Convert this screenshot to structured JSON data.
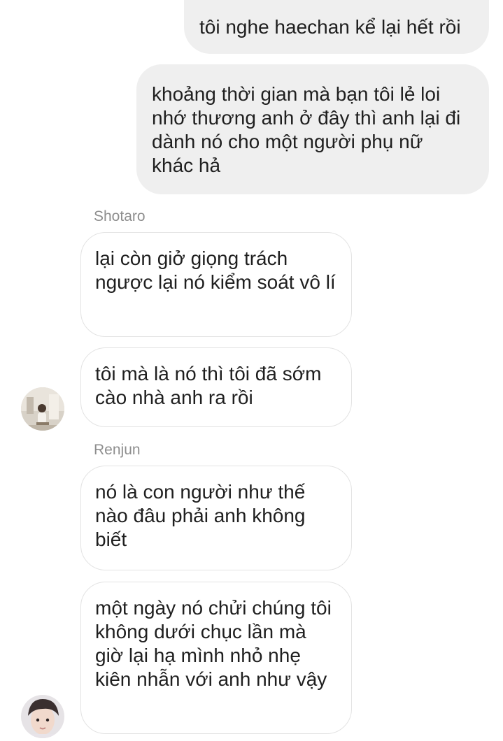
{
  "conversation": {
    "outgoing": [
      {
        "text": "tôi nghe haechan kể lại hết rồi"
      },
      {
        "text": "khoảng thời gian mà bạn tôi lẻ loi nhớ thương anh ở đây thì anh lại đi dành nó cho một người phụ nữ khác hả"
      }
    ],
    "groups": [
      {
        "sender": "Shotaro",
        "avatar_icon": "profile-photo-icon",
        "messages": [
          {
            "text": "lại còn giở giọng trách ngược lại nó kiểm soát vô lí"
          },
          {
            "text": "tôi mà là nó thì tôi đã sớm cào nhà anh ra rồi"
          }
        ]
      },
      {
        "sender": "Renjun",
        "avatar_icon": "profile-photo-icon",
        "messages": [
          {
            "text": "nó là con người như thế nào đâu phải anh không biết"
          },
          {
            "text": "một ngày nó chửi chúng tôi không dưới chục lần mà giờ lại hạ mình nhỏ nhẹ kiên nhẫn với anh như vậy"
          }
        ]
      }
    ]
  },
  "colors": {
    "outgoing_bubble": "#efefef",
    "incoming_border": "#e3e3e3",
    "sender_label": "#8e8e8e",
    "text": "#1f1f1f"
  }
}
